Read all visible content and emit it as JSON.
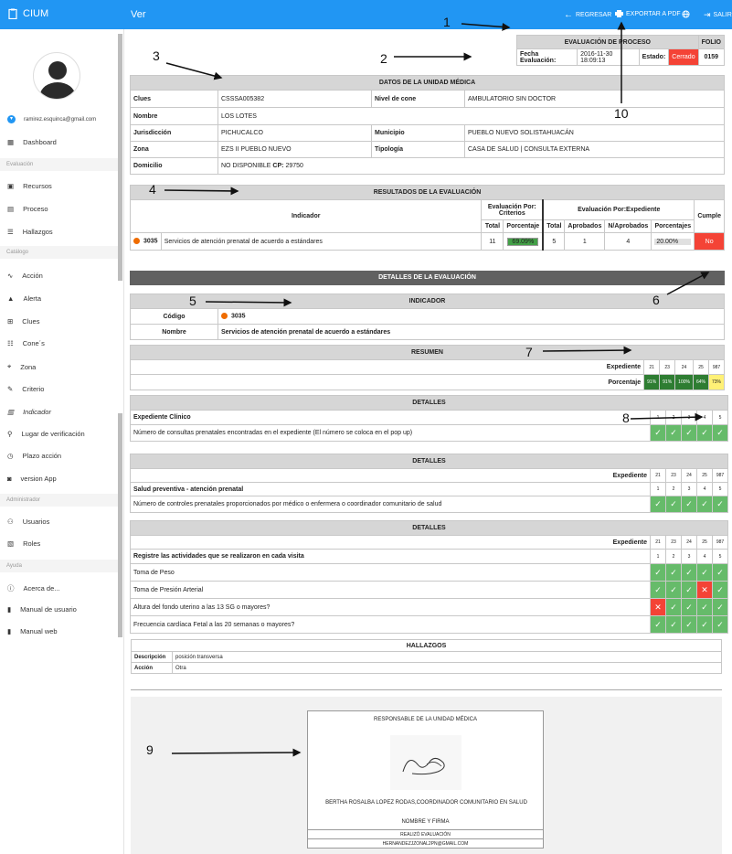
{
  "app": {
    "name": "CIUM",
    "page_title": "Ver"
  },
  "topbar": {
    "back": "REGRESAR",
    "pdf": "EXPORTAR A PDF",
    "exit": "SALIR"
  },
  "user": {
    "email": "ramirez.esquinca@gmail.com"
  },
  "sidebar": {
    "dashboard": "Dashboard",
    "sec_eval": "Evaluación",
    "recursos": "Recursos",
    "proceso": "Proceso",
    "hallazgos": "Hallazgos",
    "sec_cat": "Catálogo",
    "accion": "Acción",
    "alerta": "Alerta",
    "clues": "Clues",
    "cones": "Cone´s",
    "zona": "Zona",
    "criterio": "Criterio",
    "indicador": "Indicador",
    "lugar": "Lugar de verificación",
    "plazo": "Plazo acción",
    "version": "version App",
    "sec_admin": "Administrador",
    "usuarios": "Usuarios",
    "roles": "Roles",
    "sec_ayuda": "Ayuda",
    "acerca": "Acerca de...",
    "manual_usuario": "Manual de usuario",
    "manual_web": "Manual web"
  },
  "folio_box": {
    "title": "EVALUACIÓN DE PROCESO",
    "folio_label": "FOLIO",
    "fecha_label": "Fecha Evaluación:",
    "fecha": "2016-11-30 18:09:13",
    "estado_label": "Estado:",
    "estado": "Cerrado",
    "folio": "0159"
  },
  "unidad": {
    "title": "DATOS DE LA UNIDAD MÉDICA",
    "clues_l": "Clues",
    "clues": "CSSSA005382",
    "nivel_l": "Nivel de cone",
    "nivel": "AMBULATORIO SIN DOCTOR",
    "nombre_l": "Nombre",
    "nombre": "LOS LOTES",
    "juris_l": "Jurisdicción",
    "juris": "PICHUCALCO",
    "mun_l": "Municipio",
    "mun": "PUEBLO NUEVO SOLISTAHUACÁN",
    "zona_l": "Zona",
    "zona": "EZS II PUEBLO NUEVO",
    "tipo_l": "Tipología",
    "tipo": "CASA DE SALUD | CONSULTA EXTERNA",
    "dom_l": "Domicilio",
    "dom": "NO DISPONIBLE",
    "cp_l": "CP:",
    "cp": "29750"
  },
  "resultados": {
    "title": "RESULTADOS DE LA EVALUACIÓN",
    "indicador_h": "Indicador",
    "crit_h": "Evaluación Por: Criterios",
    "exp_h": "Evaluación Por:Expediente",
    "cumple_h": "Cumple",
    "total_h": "Total",
    "porc_h": "Porcentaje",
    "aprob_h": "Aprobados",
    "naprob_h": "N/Aprobados",
    "porcs_h": "Porcentajes",
    "code": "3035",
    "name": "Servicios de atención prenatal de acuerdo a estándares",
    "total": "11",
    "porc": "69.09%",
    "etotal": "5",
    "aprob": "1",
    "naprob": "4",
    "eporc": "20.00%",
    "cumple": "No"
  },
  "detalles_title": "DETALLES DE LA EVALUACIÓN",
  "indicador_box": {
    "title": "INDICADOR",
    "code_l": "Código",
    "code": "3035",
    "name_l": "Nombre",
    "name": "Servicios de atención prenatal de acuerdo a estándares"
  },
  "resumen": {
    "title": "RESUMEN",
    "exp_l": "Expediente",
    "porc_l": "Porcentaje",
    "exps": [
      "21",
      "23",
      "24",
      "25",
      "987"
    ],
    "porcs": [
      "91%",
      "91%",
      "100%",
      "64%",
      "73%"
    ]
  },
  "det1": {
    "title": "DETALLES",
    "group": "Expediente Clínico",
    "nums": [
      "1",
      "2",
      "3",
      "4",
      "5"
    ],
    "q": "Número de consultas prenatales encontradas en el expediente (El número se coloca en el pop up)",
    "marks": [
      "✓",
      "✓",
      "✓",
      "✓",
      "✓"
    ]
  },
  "det2": {
    "title": "DETALLES",
    "exp_l": "Expediente",
    "exps": [
      "21",
      "23",
      "24",
      "25",
      "987"
    ],
    "group": "Salud preventiva - atención prenatal",
    "nums": [
      "1",
      "2",
      "3",
      "4",
      "5"
    ],
    "q": "Número de controles prenatales proporcionados por médico o enfermera o coordinador comunitario de salud",
    "marks": [
      "✓",
      "✓",
      "✓",
      "✓",
      "✓"
    ]
  },
  "det3": {
    "title": "DETALLES",
    "exp_l": "Expediente",
    "exps": [
      "21",
      "23",
      "24",
      "25",
      "987"
    ],
    "group": "Registre las actividades que se realizaron en cada visita",
    "nums": [
      "1",
      "2",
      "3",
      "4",
      "5"
    ],
    "rows": [
      {
        "q": "Toma de Peso",
        "m": [
          "✓",
          "✓",
          "✓",
          "✓",
          "✓"
        ]
      },
      {
        "q": "Toma de Presión Arterial",
        "m": [
          "✓",
          "✓",
          "✓",
          "✕",
          "✓"
        ]
      },
      {
        "q": "Altura del fondo uterino a las 13 SG o mayores?",
        "m": [
          "✕",
          "✓",
          "✓",
          "✓",
          "✓"
        ]
      },
      {
        "q": "Frecuencia cardíaca Fetal a las 20 semanas o mayores?",
        "m": [
          "✓",
          "✓",
          "✓",
          "✓",
          "✓"
        ]
      }
    ]
  },
  "hallazgos": {
    "title": "HALLAZGOS",
    "desc_l": "Descripción",
    "desc": "posición transversa",
    "acc_l": "Acción",
    "acc": "Otra"
  },
  "firma": {
    "title": "RESPONSABLE DE LA UNIDAD MÉDICA",
    "name": "BERTHA ROSALBA LOPEZ RODAS,COORDINADOR COMUNITARIO EN SALUD",
    "nyf": "NOMBRE Y FIRMA",
    "realizo": "REALIZÓ EVALUACIÓN",
    "email": "HERNANDEZJZONAL2PN@GMAIL.COM"
  },
  "annotations": [
    "1",
    "2",
    "3",
    "4",
    "5",
    "6",
    "7",
    "8",
    "9",
    "10"
  ],
  "colors": {
    "primary": "#2196f3",
    "ok": "#66bb6a",
    "bad": "#f44336",
    "header": "#d6d6d6",
    "dark_header": "#616161"
  }
}
